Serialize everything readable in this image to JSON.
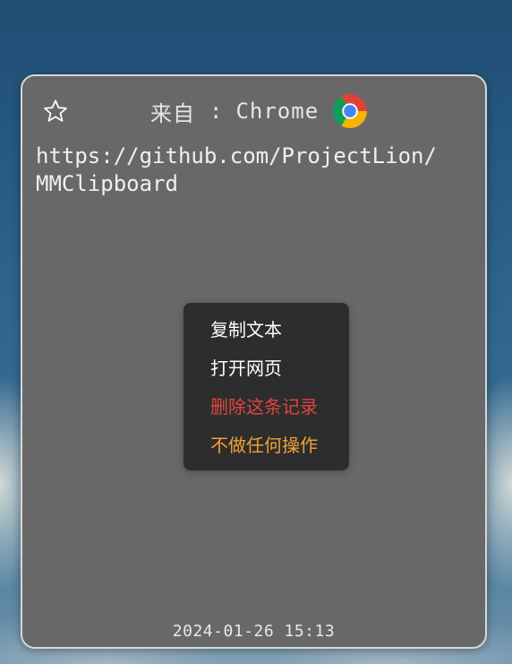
{
  "card": {
    "source_label": "来自",
    "source_separator": ":",
    "source_app": "Chrome",
    "source_app_icon": "chrome-icon",
    "star_icon": "star-outline-icon",
    "content": "https://github.com/ProjectLion/MMClipboard",
    "timestamp": "2024-01-26 15:13"
  },
  "context_menu": {
    "items": [
      {
        "label": "复制文本",
        "color": "#ffffff"
      },
      {
        "label": "打开网页",
        "color": "#ffffff"
      },
      {
        "label": "删除这条记录",
        "color": "#e0453f"
      },
      {
        "label": "不做任何操作",
        "color": "#f0a232"
      }
    ]
  },
  "colors": {
    "card_background": "#686868",
    "menu_background": "#2d2d2d",
    "chrome_red": "#db4437",
    "chrome_yellow": "#f4b400",
    "chrome_green": "#0f9d58",
    "chrome_blue": "#4285f4"
  }
}
